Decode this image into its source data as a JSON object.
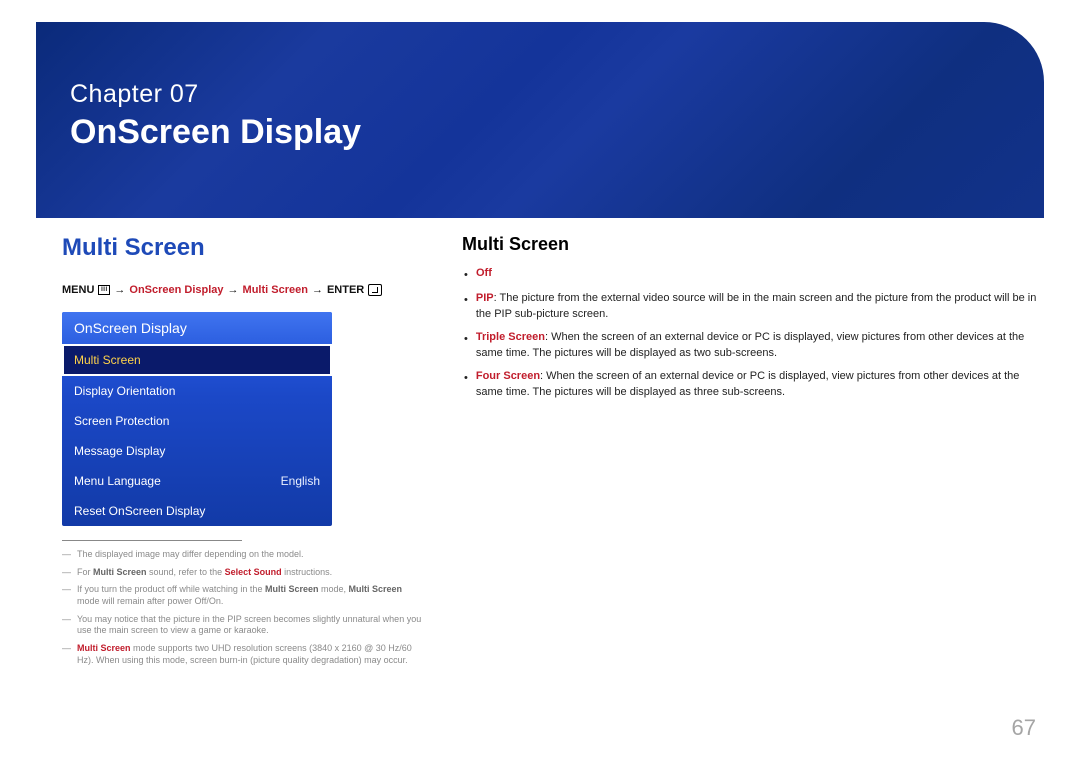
{
  "banner": {
    "chapter_label": "Chapter",
    "chapter_num": "07",
    "title": "OnScreen Display"
  },
  "page_number": "67",
  "left": {
    "heading": "Multi Screen",
    "breadcrumb": {
      "menu": "MENU",
      "arrow": "→",
      "path": [
        "OnScreen Display",
        "Multi Screen"
      ],
      "enter": "ENTER"
    },
    "panel": {
      "title": "OnScreen Display",
      "items": [
        {
          "label": "Multi Screen",
          "value": "",
          "selected": true
        },
        {
          "label": "Display Orientation",
          "value": "",
          "selected": false
        },
        {
          "label": "Screen Protection",
          "value": "",
          "selected": false
        },
        {
          "label": "Message Display",
          "value": "",
          "selected": false
        },
        {
          "label": "Menu Language",
          "value": "English",
          "selected": false
        },
        {
          "label": "Reset OnScreen Display",
          "value": "",
          "selected": false
        }
      ]
    },
    "footnotes": [
      {
        "segments": [
          {
            "t": "The displayed image may differ depending on the model."
          }
        ]
      },
      {
        "segments": [
          {
            "t": "For "
          },
          {
            "t": "Multi Screen",
            "cls": "b"
          },
          {
            "t": " sound, refer to the "
          },
          {
            "t": "Select Sound",
            "cls": "red"
          },
          {
            "t": " instructions."
          }
        ]
      },
      {
        "segments": [
          {
            "t": "If you turn the product off while watching in the "
          },
          {
            "t": "Multi Screen",
            "cls": "b"
          },
          {
            "t": " mode, "
          },
          {
            "t": "Multi Screen",
            "cls": "b"
          },
          {
            "t": " mode will remain after power Off/On."
          }
        ]
      },
      {
        "segments": [
          {
            "t": "You may notice that the picture in the PIP screen becomes slightly unnatural when you use the main screen to view a game or karaoke."
          }
        ]
      },
      {
        "segments": [
          {
            "t": "Multi Screen",
            "cls": "red"
          },
          {
            "t": " mode supports two UHD resolution screens (3840 x 2160 @ 30 Hz/60 Hz). When using this mode, screen burn-in (picture quality degradation) may occur."
          }
        ]
      }
    ]
  },
  "right": {
    "heading": "Multi Screen",
    "bullets": [
      {
        "segments": [
          {
            "t": "Off",
            "cls": "red"
          }
        ]
      },
      {
        "segments": [
          {
            "t": "PIP",
            "cls": "red"
          },
          {
            "t": ": The picture from the external video source will be in the main screen and the picture from the product will be in the PIP sub-picture screen."
          }
        ]
      },
      {
        "segments": [
          {
            "t": "Triple Screen",
            "cls": "red"
          },
          {
            "t": ": When the screen of an external device or PC is displayed, view pictures from other devices at the same time. The pictures will be displayed as two sub-screens."
          }
        ]
      },
      {
        "segments": [
          {
            "t": "Four Screen",
            "cls": "red"
          },
          {
            "t": ": When the screen of an external device or PC is displayed, view pictures from other devices at the same time. The pictures will be displayed as three sub-screens."
          }
        ]
      }
    ]
  }
}
